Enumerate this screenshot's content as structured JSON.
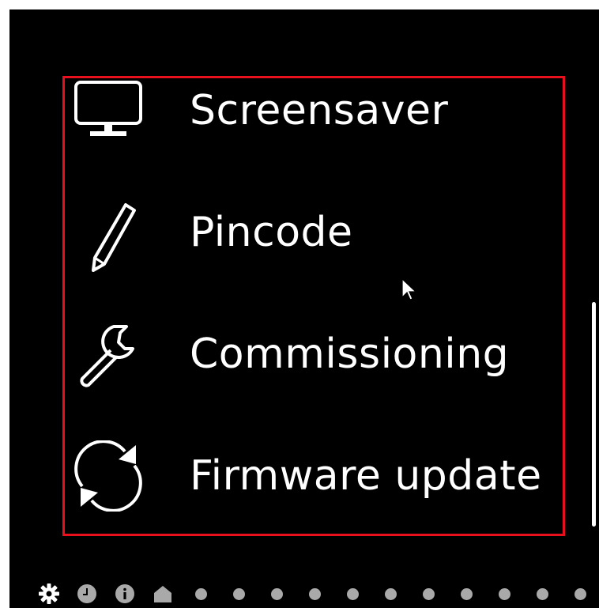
{
  "colors": {
    "background": "#000000",
    "text": "#ffffff",
    "highlight": "#e8101c",
    "pager_inactive": "#a9a9a9",
    "pager_active": "#ffffff"
  },
  "menu": {
    "items": [
      {
        "label": "Screensaver",
        "icon": "monitor-icon"
      },
      {
        "label": "Pincode",
        "icon": "pencil-icon"
      },
      {
        "label": "Commissioning",
        "icon": "wrench-icon"
      },
      {
        "label": "Firmware update",
        "icon": "refresh-icon"
      }
    ]
  },
  "pager": {
    "icons": [
      "gear-icon",
      "clock-icon",
      "info-icon",
      "home-icon"
    ],
    "dot_count": 11,
    "active_index": 0
  }
}
